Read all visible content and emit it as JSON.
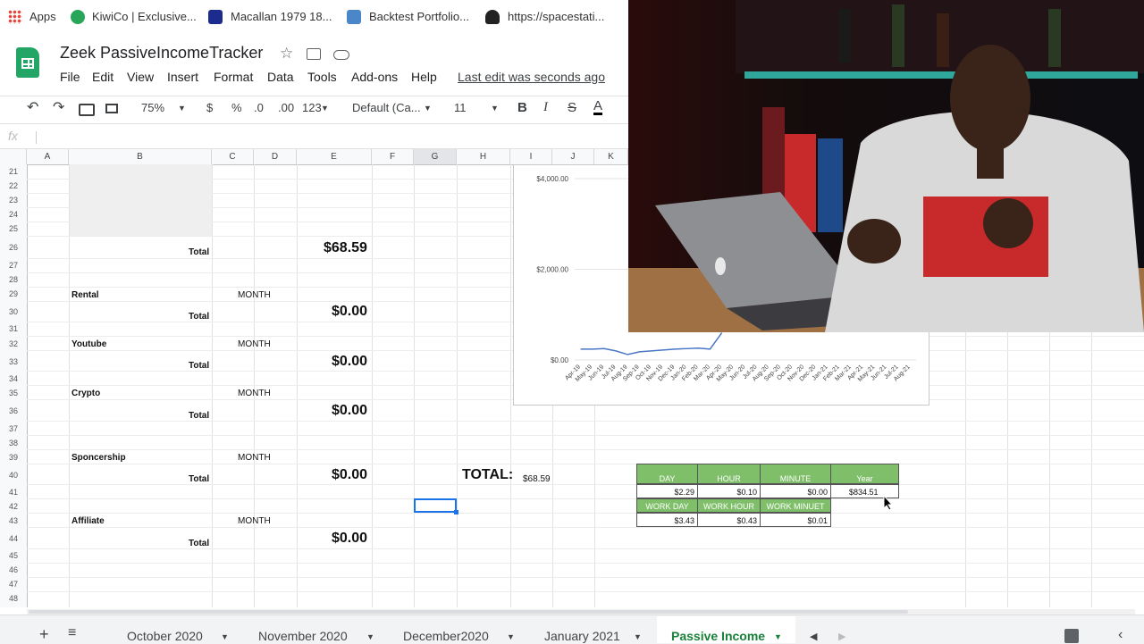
{
  "bookmarks": [
    {
      "label": "Apps",
      "icon": "apps-grid-icon"
    },
    {
      "label": "KiwiCo | Exclusive...",
      "icon": "kiwico-icon"
    },
    {
      "label": "Macallan 1979 18...",
      "icon": "macallan-icon"
    },
    {
      "label": "Backtest Portfolio...",
      "icon": "portfolio-icon"
    },
    {
      "label": "https://spacestati...",
      "icon": "spy-icon"
    }
  ],
  "document": {
    "title": "Zeek PassiveIncomeTracker"
  },
  "menu": [
    "File",
    "Edit",
    "View",
    "Insert",
    "Format",
    "Data",
    "Tools",
    "Add-ons",
    "Help"
  ],
  "last_edit": "Last edit was seconds ago",
  "toolbar": {
    "zoom": "75%",
    "currency": "$",
    "percent": "%",
    "dec_decrease": ".0",
    "dec_increase": ".00",
    "number_format": "123",
    "font": "Default (Ca...",
    "font_size": "11",
    "bold": "B",
    "italic": "I",
    "strike": "S",
    "text_color": "A"
  },
  "formula_bar": {
    "label": "fx"
  },
  "columns": [
    "A",
    "B",
    "C",
    "D",
    "E",
    "F",
    "G",
    "H",
    "I",
    "J",
    "K"
  ],
  "rows": [
    "21",
    "22",
    "23",
    "24",
    "25",
    "26",
    "27",
    "28",
    "29",
    "30",
    "31",
    "32",
    "33",
    "34",
    "35",
    "36",
    "37",
    "38",
    "39",
    "40",
    "41",
    "42",
    "43",
    "44",
    "45",
    "46",
    "47",
    "48"
  ],
  "sections": [
    {
      "total_label": "Total",
      "amount": "$68.59"
    },
    {
      "name": "Rental",
      "period": "MONTH",
      "total_label": "Total",
      "amount": "$0.00"
    },
    {
      "name": "Youtube",
      "period": "MONTH",
      "total_label": "Total",
      "amount": "$0.00"
    },
    {
      "name": "Crypto",
      "period": "MONTH",
      "total_label": "Total",
      "amount": "$0.00"
    },
    {
      "name": "Sponcership",
      "period": "MONTH",
      "total_label": "Total",
      "amount": "$0.00"
    },
    {
      "name": "Affiliate",
      "period": "MONTH",
      "total_label": "Total",
      "amount": "$0.00"
    }
  ],
  "grand_total": {
    "label": "TOTAL:",
    "value": "$68.59"
  },
  "rate_table": {
    "headers": [
      "DAY",
      "HOUR",
      "MINUTE",
      "Year"
    ],
    "values": [
      "$2.29",
      "$0.10",
      "$0.00",
      "$834.51"
    ],
    "work_headers": [
      "WORK DAY",
      "WORK HOUR",
      "WORK MINUET"
    ],
    "work_values": [
      "$3.43",
      "$0.43",
      "$0.01"
    ]
  },
  "chart_data": {
    "type": "line",
    "y_tick_labels": [
      "$4,000.00",
      "$2,000.00",
      "$0.00"
    ],
    "ylim": [
      0,
      4000
    ],
    "x": [
      "Apr-19",
      "May-19",
      "Jun-19",
      "Jul-19",
      "Aug-19",
      "Sep-19",
      "Oct-19",
      "Nov-19",
      "Dec-19",
      "Jan-20",
      "Feb-20",
      "Mar-20",
      "Apr-20",
      "May-20",
      "Jun-20",
      "Jul-20",
      "Aug-20",
      "Sep-20",
      "Oct-20",
      "Nov-20",
      "Dec-20",
      "Jan-21",
      "Feb-21",
      "Mar-21",
      "Apr-21",
      "May-21",
      "Jun-21",
      "Jul-21",
      "Aug-21"
    ],
    "series": [
      {
        "values": [
          240,
          240,
          250,
          200,
          120,
          180,
          200,
          220,
          240,
          250,
          260,
          240,
          600
        ],
        "color": "#4a76c6"
      }
    ],
    "grid": true
  },
  "sheet_tabs": [
    {
      "label": "October 2020",
      "active": false
    },
    {
      "label": "November 2020",
      "active": false
    },
    {
      "label": "December2020",
      "active": false
    },
    {
      "label": "January 2021",
      "active": false
    },
    {
      "label": "Passive Income",
      "active": true
    }
  ],
  "colors": {
    "accent_green": "#7fbf6a",
    "sheets_green": "#23a566",
    "active_tab": "#188038"
  }
}
